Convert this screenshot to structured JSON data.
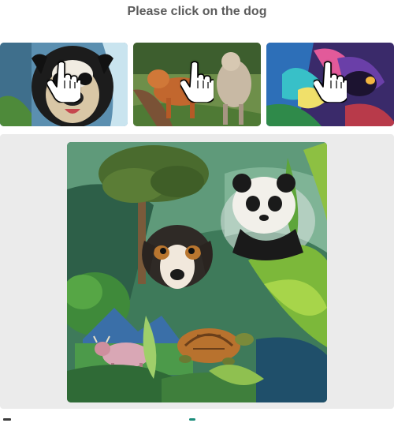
{
  "prompt": {
    "text": "Please click on the dog"
  },
  "examples": [
    {
      "subject": "pug-dog"
    },
    {
      "subject": "running-dogs"
    },
    {
      "subject": "colorful-dog"
    }
  ],
  "challenge": {
    "subject": "jungle-scene-with-dog-panda-turtle-cow"
  },
  "colors": {
    "prompt_text": "#5b5b5b",
    "panel_bg": "#ebebeb",
    "footer_accent": "#1a8c7a"
  }
}
